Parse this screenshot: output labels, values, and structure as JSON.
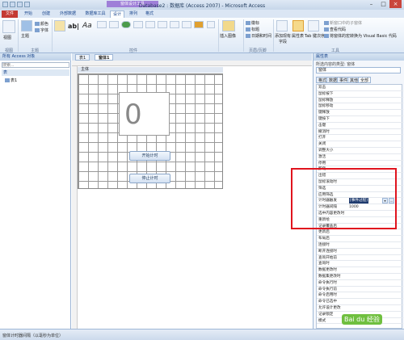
{
  "title": "Database2 : 数据库 (Access 2007) - Microsoft Access",
  "context_tab": "窗体设计工具",
  "ribbon_tabs": [
    "文件",
    "开始",
    "创建",
    "外部数据",
    "数据库工具",
    "设计",
    "排列",
    "格式"
  ],
  "ribbon": {
    "view": "视图",
    "theme": "主题",
    "colors": "颜色",
    "fonts": "字体",
    "text_ab": "ab|",
    "text_aa": "Aa",
    "insert_image": "插入图像",
    "logo": "徽标",
    "title": "标题",
    "datetime": "日期和时间",
    "add_fields": "添加现有字段",
    "property_sheet": "属性表",
    "tab_order": "Tab 键次序",
    "new_window": "新窗口中的子窗体",
    "view_code": "查看代码",
    "convert_macros": "将窗体的宏转换为 Visual Basic 代码",
    "groups": {
      "views": "视图",
      "themes": "主题",
      "controls": "控件",
      "header_footer": "页眉/页脚",
      "tools": "工具"
    }
  },
  "nav": {
    "header": "所有 Access 对象",
    "search_placeholder": "搜索...",
    "category": "表",
    "item": "表1"
  },
  "doc_tabs": [
    "表1",
    "窗体1"
  ],
  "section": "主体",
  "form": {
    "counter": "0",
    "start_button": "开始计时",
    "stop_button": "停止计时"
  },
  "props": {
    "title": "属性表",
    "subtitle": "所选内容的类型: 窗体",
    "selected": "窗体",
    "tabs": [
      "格式",
      "数据",
      "事件",
      "其他",
      "全部"
    ],
    "rows": [
      {
        "label": "双击",
        "value": ""
      },
      {
        "label": "鼠标按下",
        "value": ""
      },
      {
        "label": "鼠标释放",
        "value": ""
      },
      {
        "label": "鼠标移动",
        "value": ""
      },
      {
        "label": "键释放",
        "value": ""
      },
      {
        "label": "键按下",
        "value": ""
      },
      {
        "label": "击键",
        "value": ""
      },
      {
        "label": "撤消时",
        "value": ""
      },
      {
        "label": "打开",
        "value": ""
      },
      {
        "label": "关闭",
        "value": ""
      },
      {
        "label": "调整大小",
        "value": ""
      },
      {
        "label": "激活",
        "value": ""
      },
      {
        "label": "停用",
        "value": ""
      },
      {
        "label": "卸载",
        "value": ""
      },
      {
        "label": "出错",
        "value": ""
      },
      {
        "label": "鼠标滚动时",
        "value": ""
      },
      {
        "label": "筛选",
        "value": ""
      },
      {
        "label": "应用筛选",
        "value": ""
      },
      {
        "label": "计时器触发",
        "value": "[事件过程]"
      },
      {
        "label": "计时器间隔",
        "value": "1000"
      },
      {
        "label": "选中内容更改时",
        "value": ""
      },
      {
        "label": "重新绘",
        "value": ""
      },
      {
        "label": "记录覆盖后",
        "value": ""
      },
      {
        "label": "更新后",
        "value": ""
      },
      {
        "label": "布局后",
        "value": ""
      },
      {
        "label": "连接时",
        "value": ""
      },
      {
        "label": "断开连接时",
        "value": ""
      },
      {
        "label": "查询开始前",
        "value": ""
      },
      {
        "label": "查询时",
        "value": ""
      },
      {
        "label": "数据更改时",
        "value": ""
      },
      {
        "label": "数据集更改时",
        "value": ""
      },
      {
        "label": "命令执行时",
        "value": ""
      },
      {
        "label": "命令执行前",
        "value": ""
      },
      {
        "label": "命令启用时",
        "value": ""
      },
      {
        "label": "命令已选中",
        "value": ""
      },
      {
        "label": "允许设计更改",
        "value": ""
      },
      {
        "label": "记录锁定",
        "value": ""
      },
      {
        "label": "模式",
        "value": ""
      }
    ]
  },
  "status": "窗体计时器间隔（以毫秒为单位）",
  "watermark": "jingyan.baidu.com"
}
